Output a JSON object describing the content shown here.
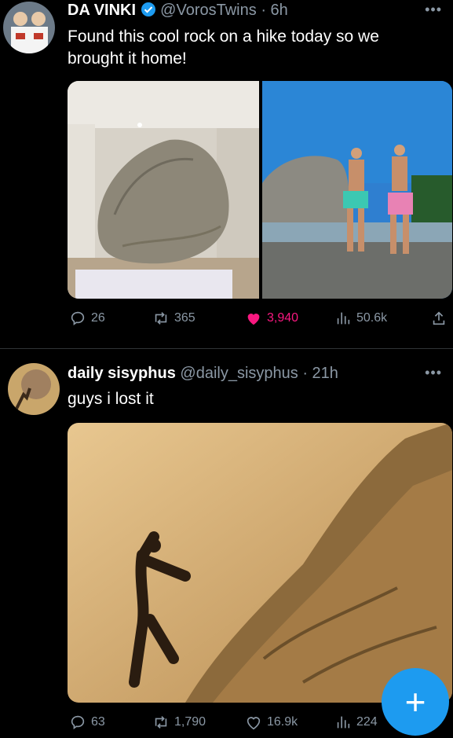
{
  "tweets": [
    {
      "name": "DA VINKI",
      "handle": "@VorosTwins",
      "time": "· 6h",
      "text_line1": "Found this cool rock on a hike today so we",
      "text_line2": "brought it home!",
      "verified": true,
      "replies": "26",
      "retweets": "365",
      "likes": "3,940",
      "views": "50.6k",
      "liked": true
    },
    {
      "name": "daily sisyphus",
      "handle": "@daily_sisyphus",
      "time": "· 21h",
      "text_line1": "guys i lost it",
      "replies": "63",
      "retweets": "1,790",
      "likes": "16.9k",
      "views": "224"
    }
  ],
  "colors": {
    "accent": "#1d9bf0",
    "like": "#f91880",
    "muted": "#8b98a5"
  },
  "icons": [
    "more-icon",
    "verified-icon",
    "reply-icon",
    "retweet-icon",
    "like-icon",
    "views-icon",
    "share-icon",
    "compose-plus-icon"
  ]
}
